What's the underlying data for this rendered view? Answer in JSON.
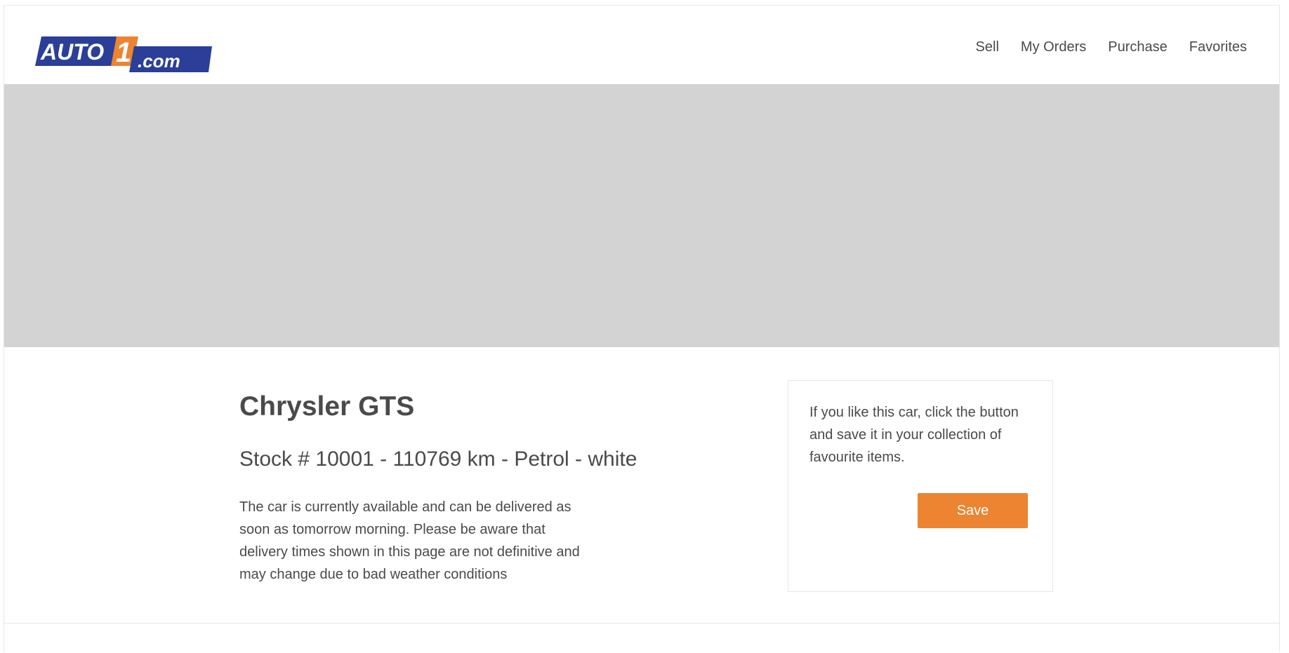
{
  "header": {
    "logo_text_main": "AUTO",
    "logo_text_number": "1",
    "logo_text_domain": ".com",
    "nav": [
      {
        "label": "Sell"
      },
      {
        "label": "My Orders"
      },
      {
        "label": "Purchase"
      },
      {
        "label": "Favorites"
      }
    ]
  },
  "car": {
    "title": "Chrysler GTS",
    "subtitle": "Stock # 10001 - 110769 km - Petrol - white",
    "description": "The car is currently available and can be delivered as soon as tomorrow morning. Please be aware that delivery times shown in this page are not definitive and may change due to bad weather conditions"
  },
  "save_panel": {
    "text": "If you like this car, click the button and save it in your collection of favourite items.",
    "button_label": "Save"
  },
  "colors": {
    "brand_blue": "#2b3e98",
    "brand_orange": "#ec8431",
    "hero_placeholder": "#d3d3d3",
    "text": "#4a4a4a"
  }
}
